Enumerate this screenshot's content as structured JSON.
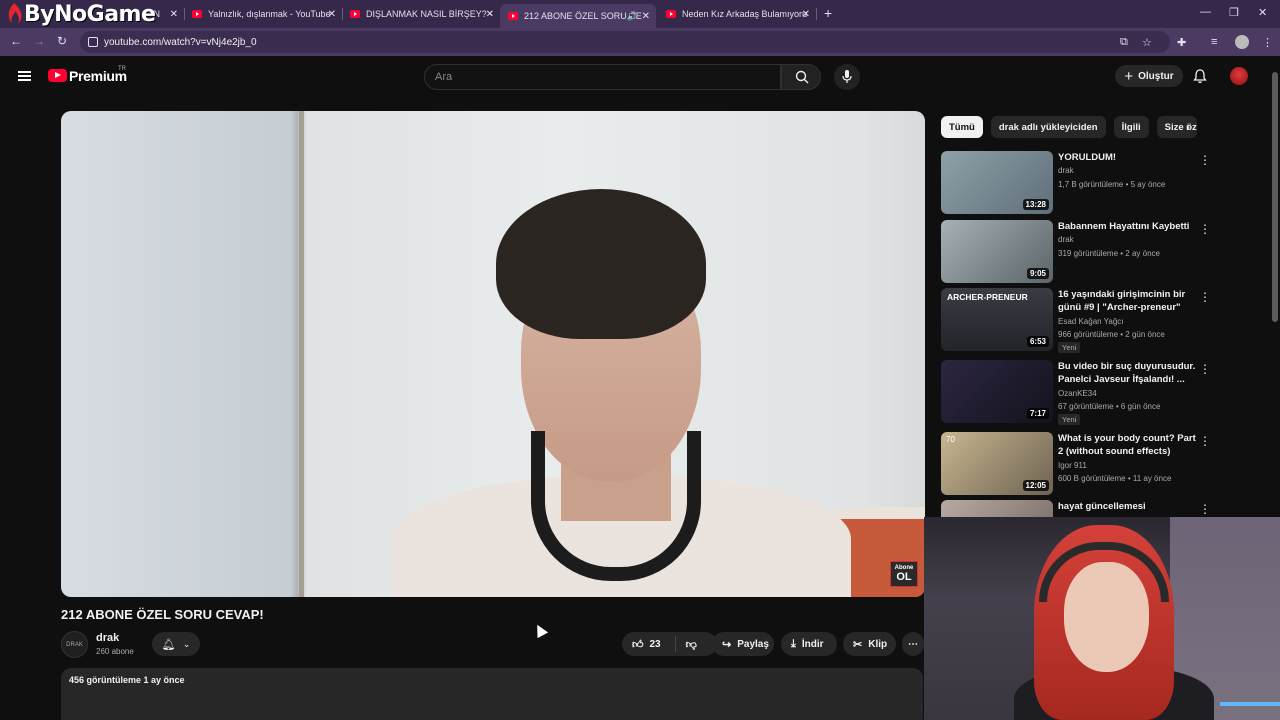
{
  "watermark": {
    "text": "ByNoGame"
  },
  "browser": {
    "tabs": [
      {
        "title": "...N"
      },
      {
        "title": "Yalnızlık, dışlanmak - YouTube"
      },
      {
        "title": "DIŞLANMAK NASIL BİRŞEY? - Y"
      },
      {
        "title": "212 ABONE ÖZEL SORU CE"
      },
      {
        "title": "Neden Kız Arkadaş Bulamıyoru"
      }
    ],
    "url": "youtube.com/watch?v=vNj4e2jb_0"
  },
  "yt": {
    "logo_text": "Premium",
    "country": "TR",
    "search_placeholder": "Ara",
    "create_label": "Oluştur"
  },
  "video": {
    "title": "212 ABONE ÖZEL SORU CEVAP!",
    "badge_top": "Abone",
    "badge_bottom": "OL",
    "channel": {
      "name": "drak",
      "subs": "260 abone",
      "avatar_text": "DRAK"
    },
    "actions": {
      "likes": "23",
      "share": "Paylaş",
      "download": "İndir",
      "clip": "Klip"
    },
    "meta": "456 görüntüleme   1 ay önce"
  },
  "rail": {
    "chips": [
      "Tümü",
      "drak adlı yükleyiciden",
      "İlgili",
      "Size öz"
    ],
    "items": [
      {
        "title": "YORULDUM!",
        "channel": "drak",
        "meta": "1,7 B görüntüleme • 5 ay önce",
        "duration": "13:28",
        "thumb": "#6d7b86"
      },
      {
        "title": "Babannem Hayattını Kaybetti",
        "channel": "drak",
        "meta": "319 görüntüleme • 2 ay önce",
        "duration": "9:05",
        "thumb": "#7e8a8f"
      },
      {
        "title": "16 yaşındaki girişimcinin bir günü #9 | \"Archer-preneur\"",
        "channel": "Esad Kağan Yağcı",
        "meta": "966 görüntüleme • 2 gün önce",
        "badge": "Yeni",
        "duration": "6:53",
        "thumb": "#2b2d33",
        "thumb_text": "ARCHER-PRENEUR"
      },
      {
        "title": "Bu video bir suç duyurusudur. Panelci Javseur İfşalandı! ...",
        "channel": "OzanKE34",
        "meta": "67 görüntüleme • 6 gün önce",
        "badge": "Yeni",
        "duration": "7:17",
        "thumb": "#1d1a2b"
      },
      {
        "title": "What is your body count? Part 2 (without sound effects)",
        "channel": "Igor 911",
        "meta": "600 B görüntüleme • 11 ay önce",
        "duration": "12:05",
        "thumb": "#9a8a6e",
        "thumb_text": "70"
      },
      {
        "title": "hayat güncellemesi",
        "channel": "",
        "meta": "",
        "duration": "",
        "thumb": "#8a7f7a"
      }
    ]
  }
}
